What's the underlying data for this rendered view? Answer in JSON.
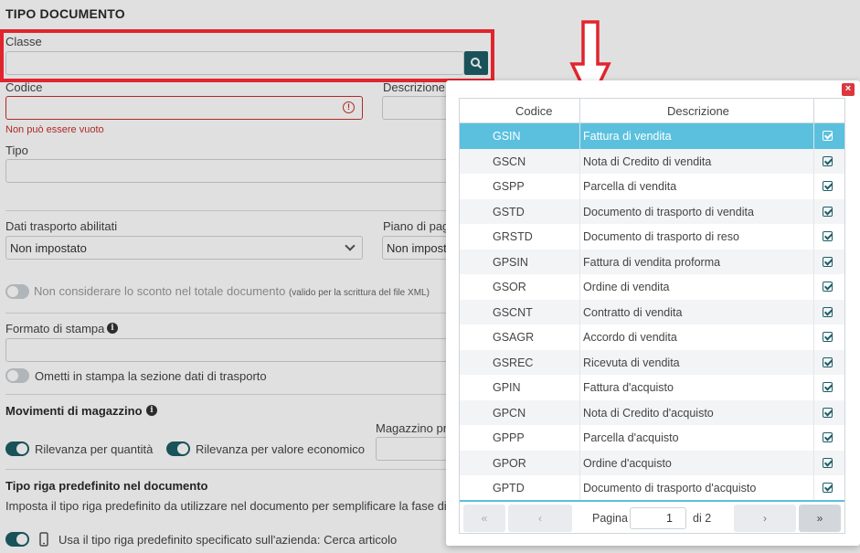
{
  "form": {
    "title": "TIPO DOCUMENTO",
    "classe_label": "Classe",
    "codice_label": "Codice",
    "descrizione_label": "Descrizione",
    "codice_error": "Non può essere vuoto",
    "tipo_label": "Tipo",
    "dati_trasporto_label": "Dati trasporto abilitati",
    "dati_trasporto_value": "Non impostato",
    "piano_label": "Piano di pag",
    "piano_value": "Non impost",
    "sconto_label": "Non considerare lo sconto nel totale documento",
    "sconto_note": "(valido per la scrittura del file XML)",
    "formato_label": "Formato di stampa",
    "ometti_label": "Ometti in stampa la sezione dati di trasporto",
    "movimenti_label": "Movimenti di magazzino",
    "magazzino_label": "Magazzino pr",
    "rilevanza_qta_label": "Rilevanza per quantità",
    "rilevanza_val_label": "Rilevanza per valore economico",
    "tipo_riga_title": "Tipo riga predefinito nel documento",
    "tipo_riga_desc": "Imposta il tipo riga predefinito da utilizzare nel documento per semplificare la fase di in",
    "usa_tipo_riga_label": "Usa il tipo riga predefinito specificato sull'azienda: Cerca articolo"
  },
  "modal": {
    "close_label": "×",
    "headers": {
      "codice": "Codice",
      "descrizione": "Descrizione"
    },
    "rows": [
      {
        "code": "GSIN",
        "desc": "Fattura di vendita"
      },
      {
        "code": "GSCN",
        "desc": "Nota di Credito di vendita"
      },
      {
        "code": "GSPP",
        "desc": "Parcella di vendita"
      },
      {
        "code": "GSTD",
        "desc": "Documento di trasporto di vendita"
      },
      {
        "code": "GRSTD",
        "desc": "Documento di trasporto di reso"
      },
      {
        "code": "GPSIN",
        "desc": "Fattura di vendita proforma"
      },
      {
        "code": "GSOR",
        "desc": "Ordine di vendita"
      },
      {
        "code": "GSCNT",
        "desc": "Contratto di vendita"
      },
      {
        "code": "GSAGR",
        "desc": "Accordo di vendita"
      },
      {
        "code": "GSREC",
        "desc": "Ricevuta di vendita"
      },
      {
        "code": "GPIN",
        "desc": "Fattura d'acquisto"
      },
      {
        "code": "GPCN",
        "desc": "Nota di Credito d'acquisto"
      },
      {
        "code": "GPPP",
        "desc": "Parcella d'acquisto"
      },
      {
        "code": "GPOR",
        "desc": "Ordine d'acquisto"
      },
      {
        "code": "GPTD",
        "desc": "Documento di trasporto d'acquisto"
      }
    ],
    "selected_index": 0,
    "pager": {
      "first": "«",
      "prev": "‹",
      "page_label": "Pagina",
      "current_page": "1",
      "of_label": "di 2",
      "next": "›",
      "last": "»"
    }
  },
  "colors": {
    "accent": "#1e5e66",
    "selection": "#5bc0de",
    "highlight": "#e0252e"
  }
}
